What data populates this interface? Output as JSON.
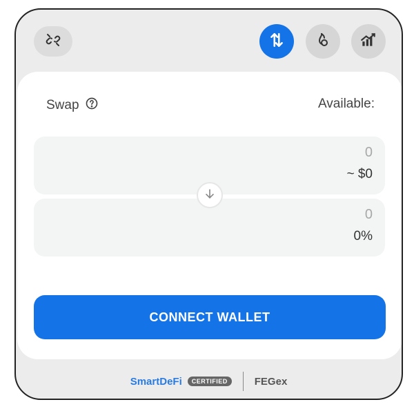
{
  "colors": {
    "accent": "#1473e6",
    "card": "#ffffff",
    "panel": "#ececec",
    "input_bg": "#f3f4f4"
  },
  "toolbar": {
    "disconnect_icon": "unlink-icon",
    "swap_icon": "swap-vertical-icon",
    "burn_icon": "flame-icon",
    "chart_icon": "chart-up-icon"
  },
  "swap": {
    "title": "Swap",
    "help_icon": "question-circle-icon",
    "available_label": "Available:"
  },
  "from": {
    "amount": "0",
    "usd_value": "~ $0"
  },
  "to": {
    "amount": "0",
    "percent": "0%"
  },
  "actions": {
    "connect_wallet": "CONNECT WALLET"
  },
  "footer": {
    "brand_smart": "Smart",
    "brand_defi": "DeFi",
    "certified": "CERTIFIED",
    "partner": "FEGex"
  }
}
